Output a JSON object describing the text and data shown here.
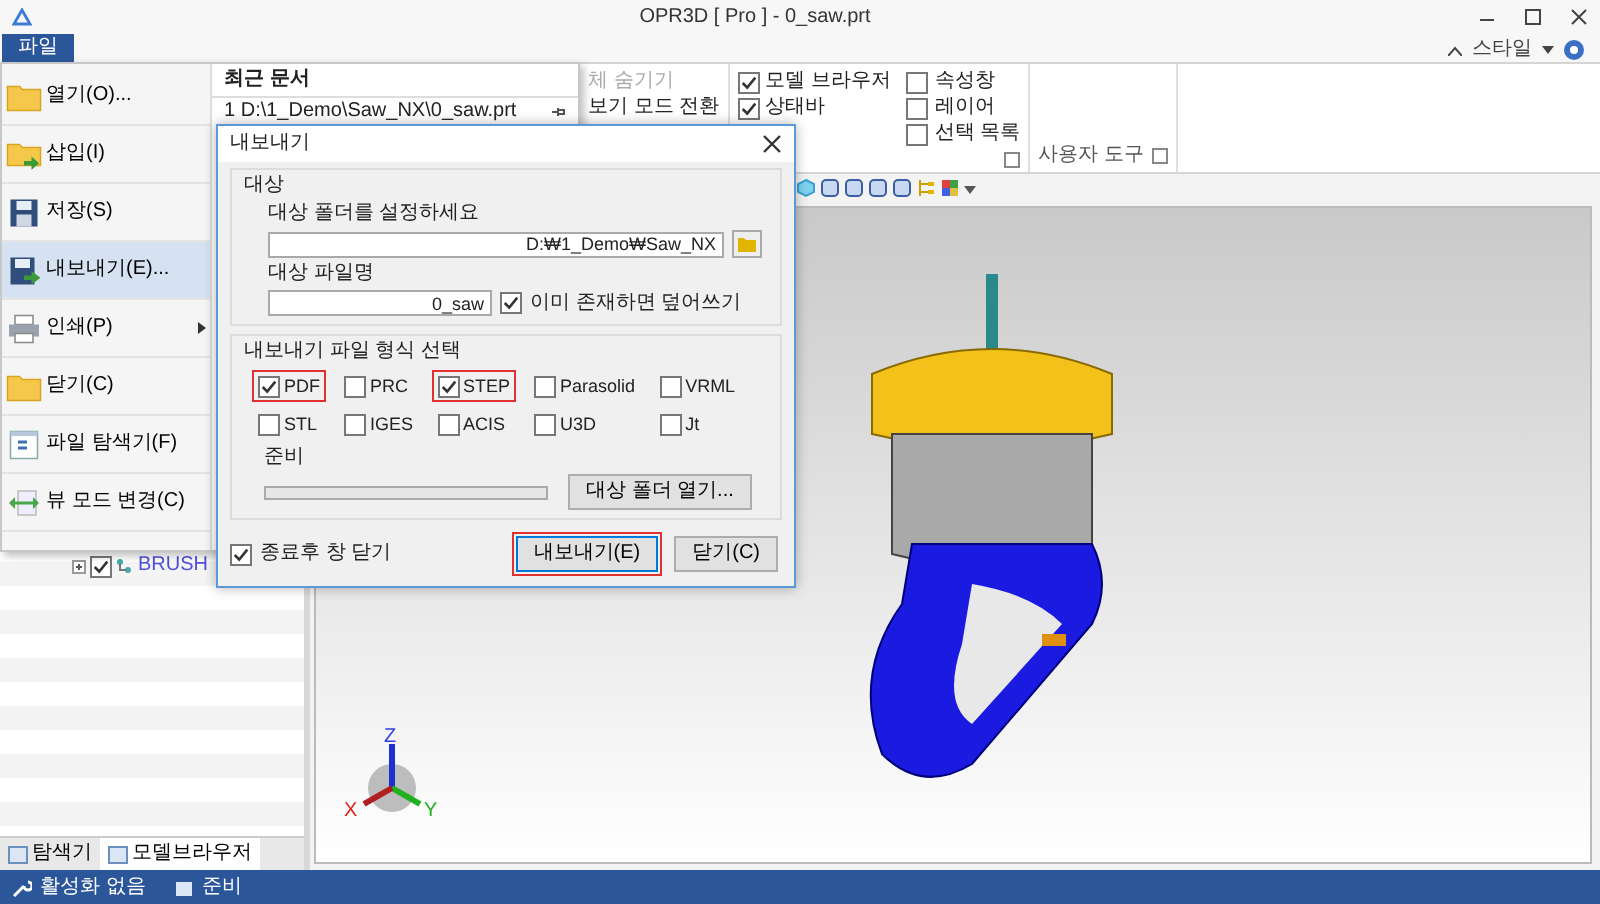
{
  "window": {
    "title": "OPR3D [ Pro ] - 0_saw.prt"
  },
  "ribbon": {
    "file_tab": "파일",
    "style_menu": "스타일",
    "view_commands": [
      {
        "label": "체 숨기기",
        "disabled": true
      },
      {
        "label": "보기 모드 전환",
        "disabled": false
      }
    ],
    "panel_options": [
      {
        "label": "모델 브라우저",
        "checked": true
      },
      {
        "label": "상태바",
        "checked": true
      },
      {
        "label": "속성창",
        "checked": false
      },
      {
        "label": "레이어",
        "checked": false
      },
      {
        "label": "선택 목록",
        "checked": false
      }
    ],
    "user_tools_group": "사용자 도구"
  },
  "file_menu": {
    "items": [
      {
        "label": "열기(O)...",
        "selected": false,
        "submenu": false
      },
      {
        "label": "삽입(I)",
        "selected": false,
        "submenu": false
      },
      {
        "label": "저장(S)",
        "selected": false,
        "submenu": false
      },
      {
        "label": "내보내기(E)...",
        "selected": true,
        "submenu": false
      },
      {
        "label": "인쇄(P)",
        "selected": false,
        "submenu": true
      },
      {
        "label": "닫기(C)",
        "selected": false,
        "submenu": false
      },
      {
        "label": "파일 탐색기(F)",
        "selected": false,
        "submenu": false
      },
      {
        "label": "뷰 모드 변경(C)",
        "selected": false,
        "submenu": false
      }
    ],
    "recent_header": "최근 문서",
    "recent": [
      {
        "index": "1",
        "path": "D:\\1_Demo\\Saw_NX\\0_saw.prt"
      }
    ]
  },
  "dialog": {
    "title": "내보내기",
    "target_group": "대상",
    "folder_label": "대상 폴더를 설정하세요",
    "folder_value": "D:₩1_Demo₩Saw_NX",
    "filename_label": "대상 파일명",
    "filename_value": "0_saw",
    "overwrite": {
      "label": "이미 존재하면 덮어쓰기",
      "checked": true
    },
    "format_group": "내보내기 파일 형식 선택",
    "formats": [
      {
        "label": "PDF",
        "checked": true,
        "highlighted": true
      },
      {
        "label": "PRC",
        "checked": false,
        "highlighted": false
      },
      {
        "label": "STEP",
        "checked": true,
        "highlighted": true
      },
      {
        "label": "Parasolid",
        "checked": false,
        "highlighted": false
      },
      {
        "label": "VRML",
        "checked": false,
        "highlighted": false
      },
      {
        "label": "STL",
        "checked": false,
        "highlighted": false
      },
      {
        "label": "IGES",
        "checked": false,
        "highlighted": false
      },
      {
        "label": "ACIS",
        "checked": false,
        "highlighted": false
      },
      {
        "label": "U3D",
        "checked": false,
        "highlighted": false
      },
      {
        "label": "Jt",
        "checked": false,
        "highlighted": false
      }
    ],
    "progress_label": "준비",
    "progress": {
      "level": 0
    },
    "open_folder_button": "대상 폴더 열기...",
    "close_after": {
      "label": "종료후 창 닫기",
      "checked": true
    },
    "buttons": [
      {
        "label": "내보내기(E)",
        "highlighted": true
      },
      {
        "label": "닫기(C)",
        "highlighted": false
      }
    ]
  },
  "tree": {
    "items": [
      {
        "label": "BRUSH",
        "checked": true
      }
    ]
  },
  "panel_tabs": [
    {
      "label": "탐색기",
      "selected": false
    },
    {
      "label": "모델브라우저",
      "selected": true
    }
  ],
  "viewport": {
    "axis_labels": {
      "x": "X",
      "y": "Y",
      "z": "Z"
    }
  },
  "status_bar": {
    "items": [
      "활성화 없음",
      "준비"
    ]
  }
}
